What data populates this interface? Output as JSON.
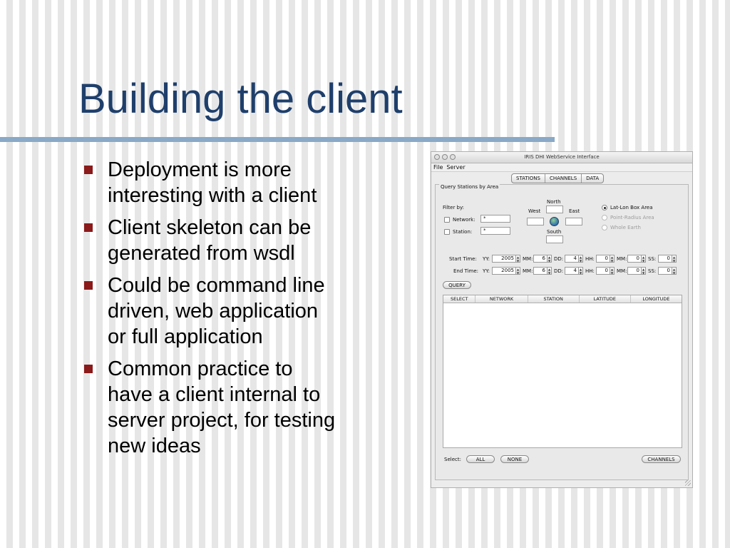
{
  "slide": {
    "title": "Building the client",
    "bullets": [
      [
        "Deployment is more",
        "interesting with a client"
      ],
      [
        "Client skeleton can be",
        "generated from wsdl"
      ],
      [
        "Could be command line",
        "driven, web application",
        "or full application"
      ],
      [
        "Common practice to",
        "have a client internal to",
        "server project, for testing",
        "new ideas"
      ]
    ]
  },
  "window": {
    "title": "IRIS DHI WebService Interface",
    "menu": [
      "File",
      "Server"
    ],
    "tabs": [
      "STATIONS",
      "CHANNELS",
      "DATA"
    ],
    "panel_title": "Query Stations by Area",
    "filter": {
      "label": "Filter by:",
      "network_label": "Network:",
      "network_value": "*",
      "station_label": "Station:",
      "station_value": "*"
    },
    "box": {
      "north": "North",
      "south": "South",
      "west": "West",
      "east": "East"
    },
    "area_options": [
      "Lat-Lon Box Area",
      "Point-Radius Area",
      "Whole Earth"
    ],
    "time": {
      "start_label": "Start Time:",
      "end_label": "End Time:",
      "field_labels": [
        "YY:",
        "MM:",
        "DD:",
        "HH:",
        "MM:",
        "SS:"
      ],
      "start_values": [
        "2005",
        "6",
        "4",
        "0",
        "0",
        "0"
      ],
      "end_values": [
        "2005",
        "6",
        "4",
        "0",
        "0",
        "0"
      ]
    },
    "query_button": "QUERY",
    "columns": [
      "SELECT",
      "NETWORK",
      "STATION",
      "LATITUDE",
      "LONGITUDE"
    ],
    "select_label": "Select:",
    "all_button": "ALL",
    "none_button": "NONE",
    "channels_button": "CHANNELS"
  }
}
